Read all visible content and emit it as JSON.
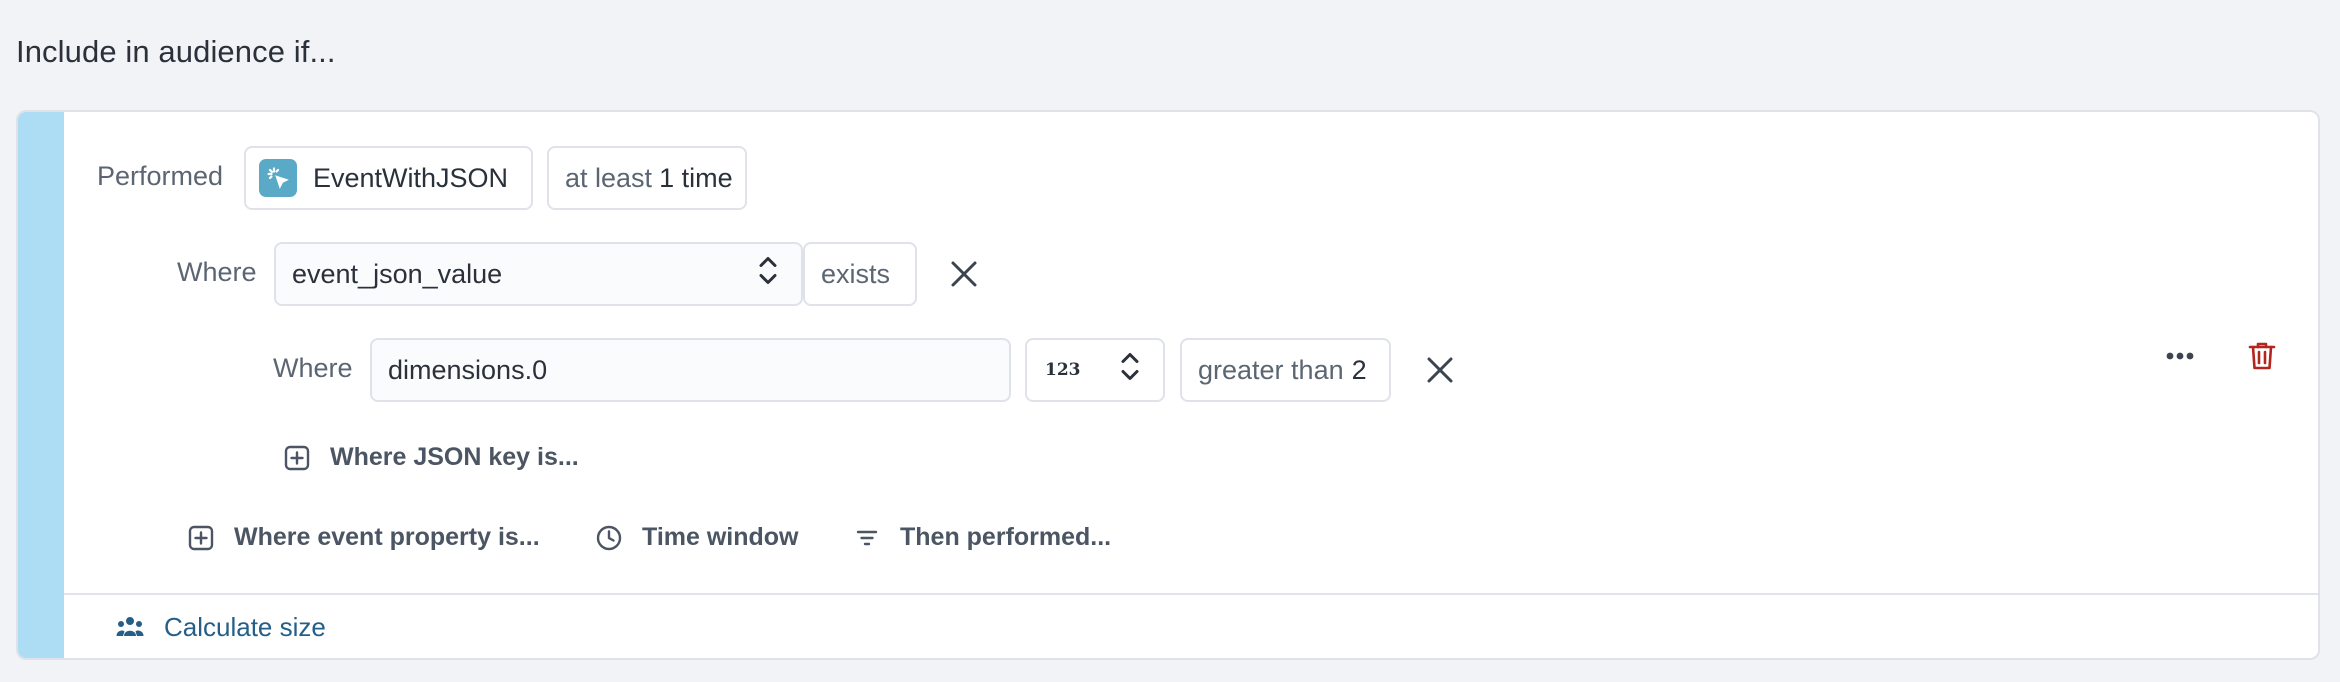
{
  "heading": "Include in audience if...",
  "condition": {
    "performed_label": "Performed",
    "event_name": "EventWithJSON",
    "frequency_prefix": "at least",
    "frequency_value": "1 time",
    "where1": {
      "label": "Where",
      "property": "event_json_value",
      "operator": "exists"
    },
    "where2": {
      "label": "Where",
      "key_path": "dimensions.0",
      "type_label": "123",
      "operator": "greater than",
      "value": "2"
    },
    "add_json_key_label": "Where JSON key is...",
    "add_event_property_label": "Where event property is...",
    "time_window_label": "Time window",
    "then_performed_label": "Then performed..."
  },
  "footer": {
    "calculate_size_label": "Calculate size"
  },
  "colors": {
    "accent_bar": "#addcf5",
    "event_icon_bg": "#5aaac7",
    "link": "#255f88",
    "delete": "#b3261e"
  },
  "icons": {
    "event": "cursor-click-icon",
    "close": "close-icon",
    "plus_box": "plus-square-icon",
    "clock": "clock-icon",
    "filter": "filter-lines-icon",
    "people": "users-icon",
    "more": "more-horizontal-icon",
    "trash": "trash-icon",
    "chevrons": "chevron-up-down-icon"
  }
}
